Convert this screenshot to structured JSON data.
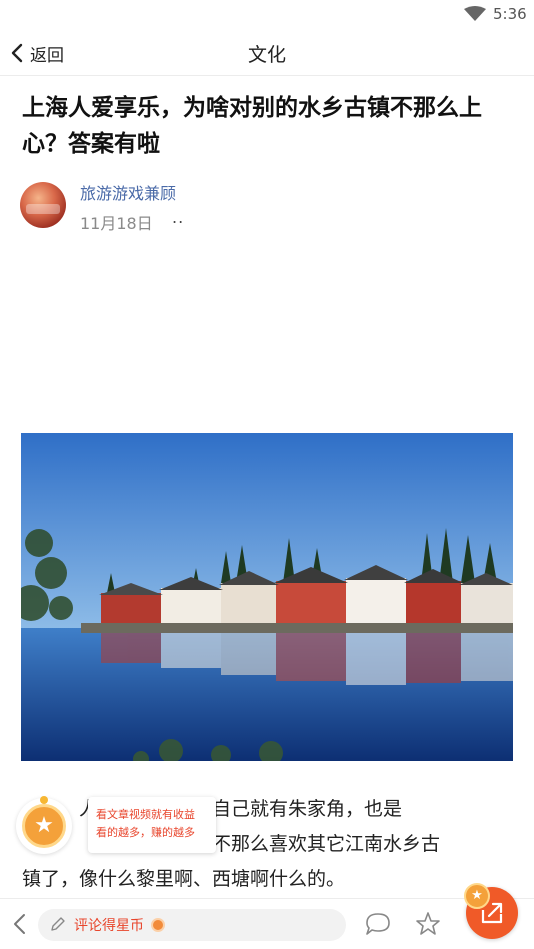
{
  "status_bar": {
    "time": "5:36"
  },
  "nav": {
    "back_label": "返回",
    "title": "文化"
  },
  "article": {
    "title": "上海人爱享乐，为啥对别的水乡古镇不那么上心？答案有啦",
    "author": "旅游游戏兼顾",
    "date": "11月18日",
    "more": "..",
    "body_line_1": "　　　人，是好幸福，自己就有朱家角，也是",
    "body_line_2": "　　　　　　　任性地不那么喜欢其它江南水乡古",
    "body_line_3": "镇了，像什么黎里啊、西塘啊什么的。"
  },
  "reward": {
    "tip_line_1": "看文章视频就有收益",
    "tip_line_2": "看的越多，赚的越多"
  },
  "bottom_bar": {
    "comment_placeholder": "评论得星币"
  },
  "colors": {
    "accent": "#e8452c",
    "share": "#f05a28",
    "coin": "#f4a13a",
    "author_link": "#4a6aa8"
  },
  "icons": [
    "wifi-icon",
    "battery-icon",
    "back-chevron-icon",
    "pen-icon",
    "coin-icon",
    "comment-icon",
    "star-icon",
    "share-icon"
  ]
}
